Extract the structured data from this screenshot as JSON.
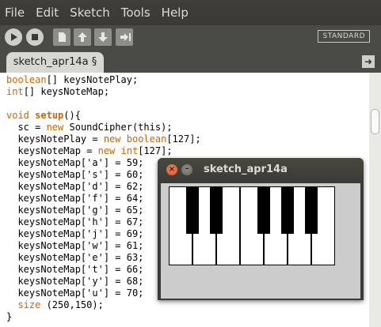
{
  "menubar": {
    "items": [
      "File",
      "Edit",
      "Sketch",
      "Tools",
      "Help"
    ]
  },
  "toolbar": {
    "buttons": [
      "run-icon",
      "stop-icon",
      "new-icon",
      "open-icon",
      "save-icon",
      "export-icon"
    ],
    "mode": "STANDARD"
  },
  "tabs": {
    "active": "sketch_apr14a §",
    "menu_icon": "arrow-right-icon"
  },
  "editor": {
    "lines": [
      "boolean[] keysNotePlay;",
      "int[] keysNoteMap;",
      "",
      "void setup(){",
      "  sc = new SoundCipher(this);",
      "  keysNotePlay = new boolean[127];",
      "  keysNoteMap = new int[127];",
      "  keysNoteMap['a'] = 59;",
      "  keysNoteMap['s'] = 60;",
      "  keysNoteMap['d'] = 62;",
      "  keysNoteMap['f'] = 64;",
      "  keysNoteMap['g'] = 65;",
      "  keysNoteMap['h'] = 67;",
      "  keysNoteMap['j'] = 69;",
      "  keysNoteMap['w'] = 61;",
      "  keysNoteMap['e'] = 63;",
      "  keysNoteMap['t'] = 66;",
      "  keysNoteMap['y'] = 68;",
      "  keysNoteMap['u'] = 70;",
      "  size (250,150);",
      "}"
    ]
  },
  "sketch_window": {
    "title": "sketch_apr14a",
    "close_icon": "close-icon",
    "minimize_icon": "minimize-icon",
    "white_keys": 7,
    "black_keys": 5
  }
}
